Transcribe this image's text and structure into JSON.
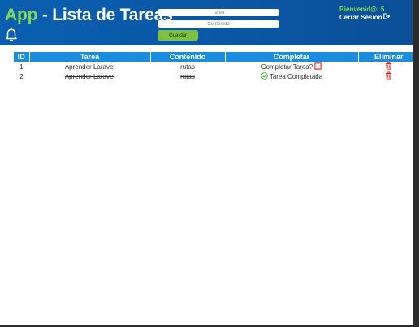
{
  "header": {
    "brand": "App",
    "title_rest": " - Lista de Tareas",
    "welcome": "Bienvenid@: 5",
    "logout": "Cerrar Sesion",
    "bell_icon": "bell-icon",
    "logout_icon": "sign-out-icon"
  },
  "form": {
    "tarea_placeholder": "Tarea",
    "contenido_placeholder": "Contenido",
    "save_label": "Guardar"
  },
  "table": {
    "headers": [
      "ID",
      "Tarea",
      "Contenido",
      "Completar",
      "Eliminar"
    ],
    "rows": [
      {
        "id": "1",
        "tarea": "Aprender Laravel",
        "contenido": "rutas",
        "completar": "Completar Tarea?",
        "completed": false
      },
      {
        "id": "2",
        "tarea": "Aprender Laravel",
        "contenido": "rutas",
        "completar": "Tarea Completada",
        "completed": true
      }
    ]
  },
  "colors": {
    "header_bg": "#0b5fb0",
    "brand_green": "#7ed957",
    "table_header": "#1a8de0",
    "save_button": "#7ec142",
    "done_green": "#3aa53a",
    "danger_red": "#e02020"
  }
}
